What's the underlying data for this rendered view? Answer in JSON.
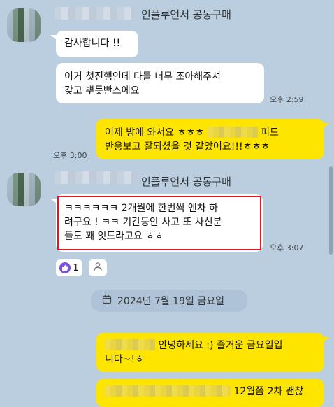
{
  "chat": {
    "sender1": "인플루언서 공동구매",
    "msg1": "감사합니다 !!",
    "msg2": "이거 첫진행인데 다들 너무 조아해주셔\n갖고 뿌듯빤스에요",
    "time1": "오후 2:59",
    "msg3a": "어제 밤에 와서요 ㅎㅎㅎ",
    "msg3b": "피드",
    "msg3c": "반응보고 잘되셨을 것 같았어요!!!ㅎㅎㅎ",
    "time2": "오후 3:00",
    "sender2": "인플루언서 공동구매",
    "msg4": "ㅋㅋㅋㅋㅋㅋ 2개월에 한번씩 엔차 하\n려구요 ! ㅋㅋ 기간동안 사고 또 사신분\n들도 꽤 잇드라고요 ㅎㅎ",
    "time3": "오후 3:07",
    "reaction_count": "1",
    "date_divider": "2024년 7월 19일 금요일",
    "msg5a": "안녕하세요 :) 즐거운 금요일입",
    "msg5b": "니다~!ㅎ",
    "msg6": "12월쯤 2차 괜찮"
  },
  "colors": {
    "background": "#bacee0",
    "my_bubble": "#fee500",
    "other_bubble": "#ffffff",
    "highlight_box": "#d81b27",
    "reaction_accent": "#7a4fe0"
  },
  "icons": [
    "avatar",
    "calendar-icon",
    "like-reaction-icon",
    "user-outline-icon"
  ]
}
